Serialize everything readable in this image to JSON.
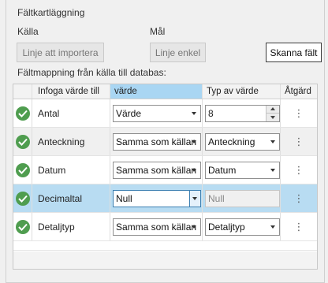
{
  "section_title": "Fältkartläggning",
  "source_label": "Källa",
  "target_label": "Mål",
  "buttons": {
    "import_line": "Linje att importera",
    "simple_line": "Linje enkel",
    "scan_fields": "Skanna fält"
  },
  "mapping_title": "Fältmappning från källa till databas:",
  "columns": [
    "Infoga värde till",
    "värde",
    "Typ av värde",
    "Åtgärd"
  ],
  "rows": [
    {
      "name": "Antal",
      "value": "Värde",
      "type_value": "8",
      "type_kind": "spinner",
      "action": "⋮"
    },
    {
      "name": "Anteckning",
      "value": "Samma som källan",
      "type_value": "Anteckning",
      "type_kind": "dropdown",
      "action": "⋮"
    },
    {
      "name": "Datum",
      "value": "Samma som källan",
      "type_value": "Datum",
      "type_kind": "dropdown",
      "action": "⋮"
    },
    {
      "name": "Decimaltal",
      "value": "Null",
      "type_value": "Null",
      "type_kind": "disabled",
      "action": "⋮"
    },
    {
      "name": "Detaljtyp",
      "value": "Samma som källan",
      "type_value": "Detaljtyp",
      "type_kind": "dropdown",
      "action": "⋮"
    }
  ],
  "colors": {
    "check": "#4f9d4f",
    "selected_row": "#b8dcf2",
    "active_header": "#a9d6f3"
  }
}
